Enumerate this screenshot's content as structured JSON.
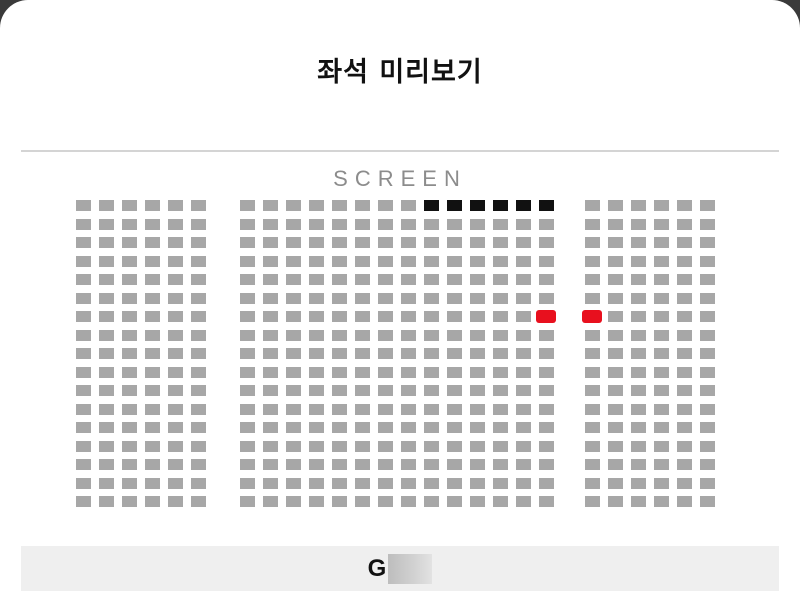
{
  "header": {
    "title": "좌석 미리보기"
  },
  "stage": {
    "label": "SCREEN"
  },
  "seatmap": {
    "rows": 17,
    "blocks": [
      {
        "name": "left",
        "columns": 6
      },
      {
        "name": "center",
        "columns": 14
      },
      {
        "name": "right",
        "columns": 6
      }
    ],
    "sold_seats": [
      {
        "block": "center",
        "row": 1,
        "col": 9
      },
      {
        "block": "center",
        "row": 1,
        "col": 10
      },
      {
        "block": "center",
        "row": 1,
        "col": 11
      },
      {
        "block": "center",
        "row": 1,
        "col": 12
      },
      {
        "block": "center",
        "row": 1,
        "col": 13
      },
      {
        "block": "center",
        "row": 1,
        "col": 14
      }
    ],
    "selected_seats": [
      {
        "block": "center",
        "row": 7,
        "col": 14
      },
      {
        "block": "right",
        "row": 7,
        "col": 1
      }
    ],
    "colors": {
      "available": "#a7a7a7",
      "sold": "#111111",
      "selected": "#e8101e"
    }
  },
  "footer": {
    "seat_label": "G"
  }
}
